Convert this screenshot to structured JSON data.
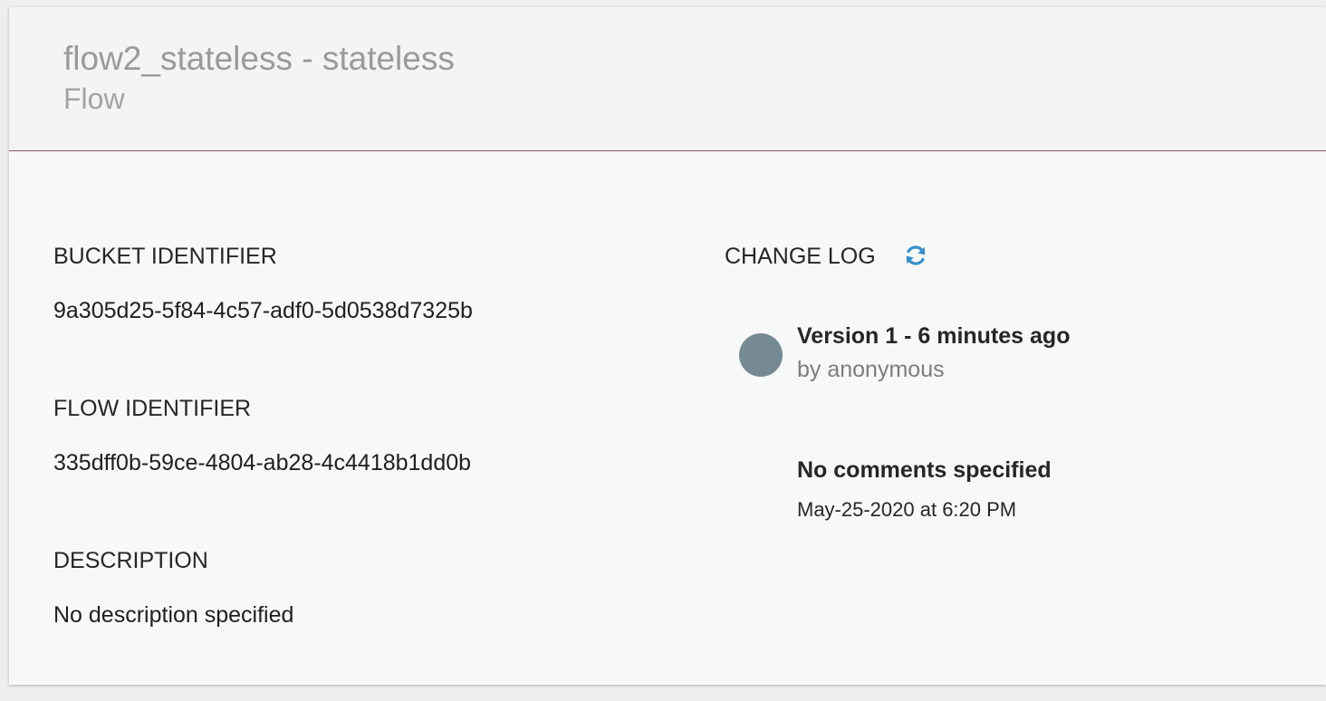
{
  "header": {
    "title": "flow2_stateless - stateless",
    "subtitle": "Flow"
  },
  "details": {
    "bucket_identifier_label": "BUCKET IDENTIFIER",
    "bucket_identifier_value": "9a305d25-5f84-4c57-adf0-5d0538d7325b",
    "flow_identifier_label": "FLOW IDENTIFIER",
    "flow_identifier_value": "335dff0b-59ce-4804-ab28-4c4418b1dd0b",
    "description_label": "DESCRIPTION",
    "description_value": "No description specified"
  },
  "changelog": {
    "label": "CHANGE LOG",
    "refresh_icon": "refresh-icon",
    "accent_color": "#3a8fc9",
    "entries": [
      {
        "title": "Version 1 - 6 minutes ago",
        "author": "by anonymous",
        "comment": "No comments specified",
        "date": "May-25-2020 at 6:20 PM",
        "avatar_color": "#768a94"
      }
    ]
  }
}
